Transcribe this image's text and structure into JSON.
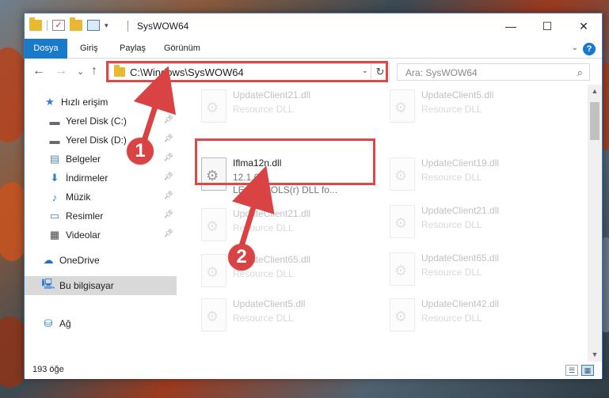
{
  "window": {
    "title": "SysWOW64",
    "controls": {
      "minimize": "—",
      "maximize": "☐",
      "close": "✕"
    }
  },
  "ribbon": {
    "tabs": [
      "Dosya",
      "Giriş",
      "Paylaş",
      "Görünüm"
    ],
    "help": "?"
  },
  "navigation": {
    "back": "←",
    "forward": "→",
    "recent": "⌄",
    "up": "↑",
    "address": "C:\\Windows\\SysWOW64",
    "search_placeholder": "Ara: SysWOW64",
    "search_icon": "search-icon",
    "refresh_icon": "refresh-icon"
  },
  "sidebar": {
    "items": [
      {
        "label": "Hızlı erişim",
        "icon": "star-icon",
        "pinned": false
      },
      {
        "label": "Yerel Disk (C:)",
        "icon": "drive-icon",
        "pinned": true
      },
      {
        "label": "Yerel Disk (D:)",
        "icon": "drive-icon",
        "pinned": true
      },
      {
        "label": "Belgeler",
        "icon": "documents-icon",
        "pinned": true
      },
      {
        "label": "İndirmeler",
        "icon": "download-icon",
        "pinned": true
      },
      {
        "label": "Müzik",
        "icon": "music-icon",
        "pinned": true
      },
      {
        "label": "Resimler",
        "icon": "pictures-icon",
        "pinned": true
      },
      {
        "label": "Videolar",
        "icon": "videos-icon",
        "pinned": true
      },
      {
        "label": "OneDrive",
        "icon": "cloud-icon",
        "pinned": false
      },
      {
        "label": "Bu bilgisayar",
        "icon": "computer-icon",
        "pinned": false,
        "selected": true
      },
      {
        "label": "Ağ",
        "icon": "network-icon",
        "pinned": false
      }
    ]
  },
  "files": {
    "left_column": [
      {
        "name": "UpdateClient21.dll",
        "line1": "Resource DLL",
        "line2": ""
      },
      {
        "name": "Iflma12n.dll",
        "line1": "12.1.0.0",
        "line2": "LEADTOOLS(r) DLL fo...",
        "highlighted": true
      },
      {
        "name": "UpdateClient21.dll",
        "line1": "Resource DLL",
        "line2": ""
      },
      {
        "name": "UpdateClient65.dll",
        "line1": "Resource DLL",
        "line2": ""
      },
      {
        "name": "UpdateClient5.dll",
        "line1": "Resource DLL",
        "line2": ""
      }
    ],
    "right_column": [
      {
        "name": "UpdateClient5.dll",
        "line1": "Resource DLL"
      },
      {
        "name": "UpdateClient19.dll",
        "line1": "Resource DLL"
      },
      {
        "name": "UpdateClient21.dll",
        "line1": "Resource DLL"
      },
      {
        "name": "UpdateClient65.dll",
        "line1": "Resource DLL"
      },
      {
        "name": "UpdateClient42.dll",
        "line1": "Resource DLL"
      }
    ]
  },
  "status": {
    "item_count": "193 öğe"
  },
  "callouts": [
    "1",
    "2"
  ],
  "colors": {
    "accent": "#1979ca",
    "highlight": "#e04848",
    "callout": "#d94343"
  }
}
